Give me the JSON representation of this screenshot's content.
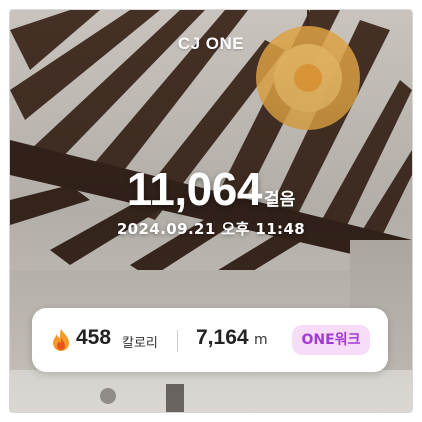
{
  "brand": {
    "logo_text": "CJ ONE"
  },
  "activity": {
    "steps": "11,064",
    "steps_unit": "걸음",
    "datetime": "2024.09.21 오후 11:48"
  },
  "stats": {
    "calories_icon": "flame-icon",
    "calories_value": "458",
    "calories_unit": "칼로리",
    "distance_value": "7,164",
    "distance_unit": "m",
    "badge_label": "ONE워크"
  },
  "colors": {
    "badge_bg": "#f6dcf7",
    "badge_text": "#a13bd1",
    "flame_outer": "#f59b23",
    "flame_inner": "#e8541c"
  }
}
